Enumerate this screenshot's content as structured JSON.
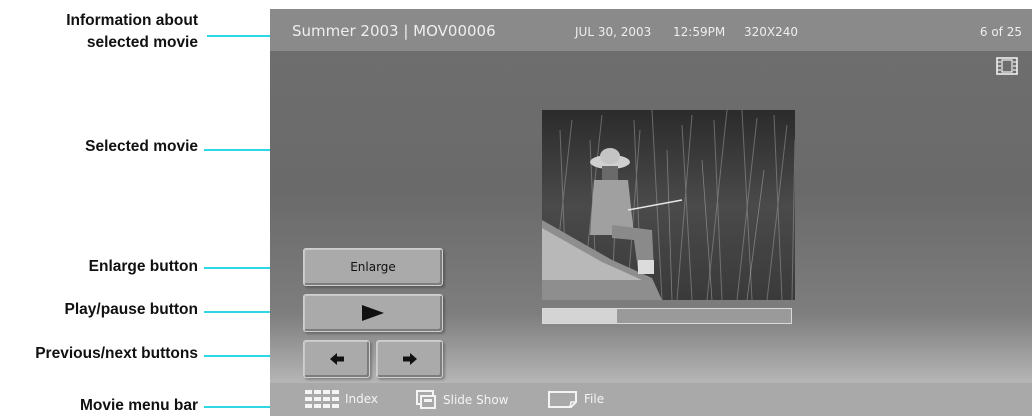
{
  "callouts": {
    "info_line1": "Information about",
    "info_line2": "selected movie",
    "selected_movie": "Selected movie",
    "enlarge": "Enlarge button",
    "play_pause": "Play/pause button",
    "prev_next": "Previous/next buttons",
    "menu_bar": "Movie menu bar"
  },
  "info_bar": {
    "title": "Summer 2003 | MOV00006",
    "date": "JUL 30, 2003",
    "time": "12:59PM",
    "resolution": "320X240",
    "position": "6 of 25"
  },
  "controls": {
    "enlarge_label": "Enlarge",
    "play_icon": "play-triangle-icon",
    "previous_icon": "arrow-left-icon",
    "next_icon": "arrow-right-icon"
  },
  "progress": {
    "value_fraction": 0.3
  },
  "menu_bar": {
    "items": [
      {
        "label": "Index",
        "icon": "grid-icon"
      },
      {
        "label": "Slide Show",
        "icon": "slideshow-icon"
      },
      {
        "label": "File",
        "icon": "folder-icon"
      }
    ]
  },
  "colors": {
    "callout_line": "#2fd6e3",
    "screen_bg": "#6f6f6f",
    "info_bar_bg": "#8a8a8a",
    "menu_bar_bg": "#a9a9a9"
  }
}
